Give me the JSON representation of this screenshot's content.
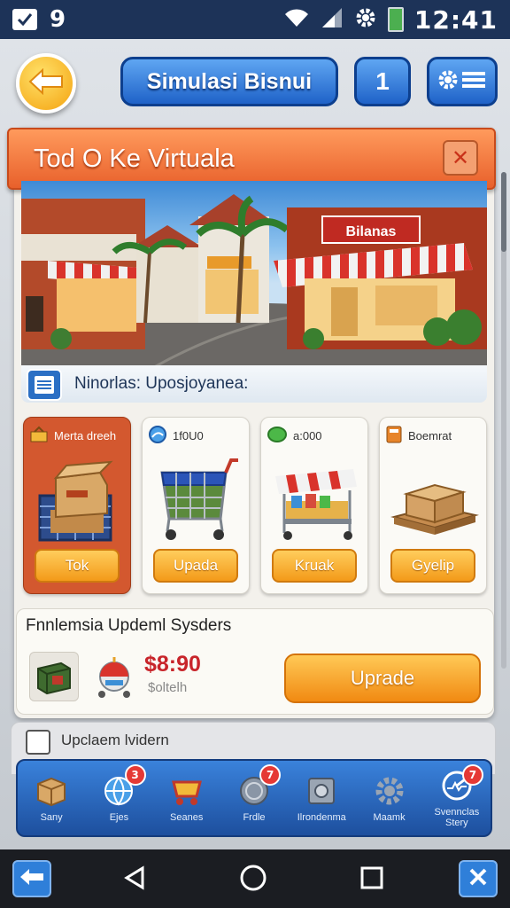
{
  "status_bar": {
    "notification_count": "9",
    "time": "12:41",
    "icons": [
      "check-notification-icon",
      "wifi-icon",
      "signal-icon",
      "settings-icon",
      "battery-icon"
    ]
  },
  "header": {
    "back_icon": "arrow-left-icon",
    "title": "Simulasi Bisnui",
    "counter": "1",
    "settings_icon": "gear-menu-icon"
  },
  "banner": {
    "title": "Tod O Ke Virtuala",
    "close_icon": "close-icon"
  },
  "scene": {
    "store_sign": "Bilanas",
    "caption": "Ninorlas: Uposjoyanea:"
  },
  "cards": [
    {
      "header": "Merta dreeh",
      "button": "Tok",
      "icon": "basket-icon",
      "image": "boxes-in-cart"
    },
    {
      "header": "1f0U0",
      "button": "Upada",
      "icon": "globe-coin-icon",
      "image": "shopping-cart"
    },
    {
      "header": "a:000",
      "button": "Kruak",
      "icon": "green-coin-icon",
      "image": "market-stall"
    },
    {
      "header": "Boemrat",
      "button": "Gyelip",
      "icon": "calculator-icon",
      "image": "pallet-boxes"
    }
  ],
  "upgrade_panel": {
    "title": "Fnnlemsia Updeml Sysders",
    "price": "$8:90",
    "price_sub": "$oltelh",
    "button": "Uprade"
  },
  "sub_panel": {
    "title": "Upclaem lvidern"
  },
  "bottom_nav": [
    {
      "label": "Sany",
      "icon": "box-icon",
      "badge": ""
    },
    {
      "label": "Ejes",
      "icon": "globe-icon",
      "badge": "3"
    },
    {
      "label": "Seanes",
      "icon": "cart-icon",
      "badge": ""
    },
    {
      "label": "Frdle",
      "icon": "coin-icon",
      "badge": "7"
    },
    {
      "label": "Ilrondenma",
      "icon": "safe-icon",
      "badge": ""
    },
    {
      "label": "Maamk",
      "icon": "gear-icon",
      "badge": ""
    },
    {
      "label": "Svennclas Stery",
      "icon": "dashboard-icon",
      "badge": "7"
    }
  ],
  "system_nav": {
    "icons": [
      "back-arrow-icon",
      "triangle-back-icon",
      "circle-home-icon",
      "square-recents-icon",
      "close-icon"
    ]
  },
  "colors": {
    "status_bar": "#1d3358",
    "accent_blue": "#1f62c8",
    "banner_orange": "#e8602b",
    "button_orange": "#f39a19",
    "price_red": "#c8252b"
  }
}
